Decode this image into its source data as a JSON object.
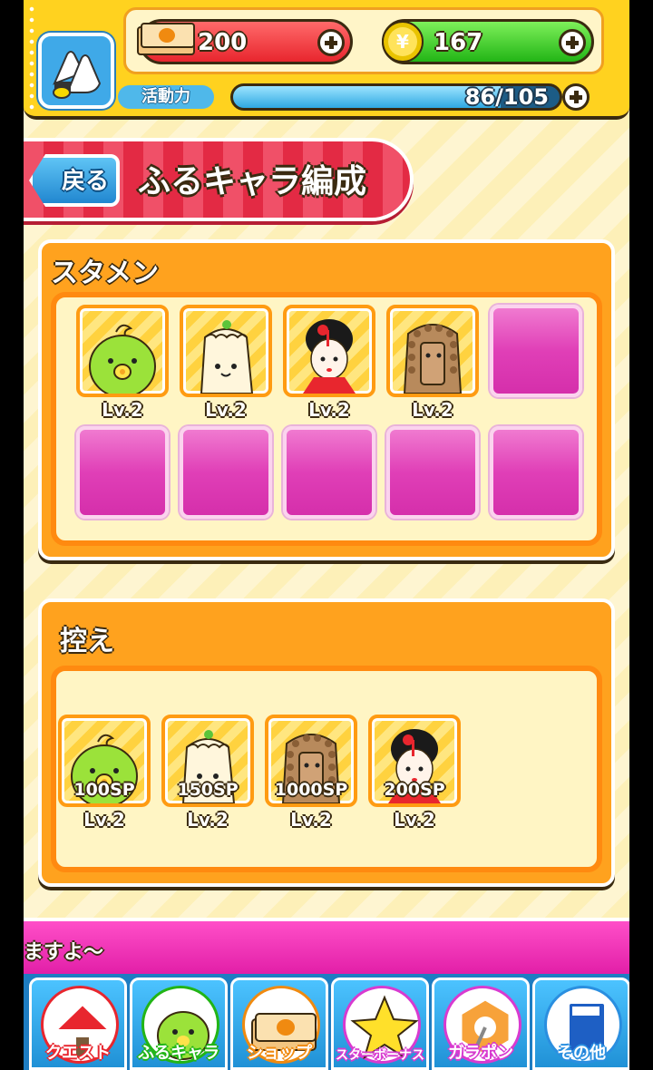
{
  "header": {
    "money": "200",
    "coins": "167",
    "energy_label": "活動力",
    "energy_text": "86/105",
    "energy_fraction": 0.819
  },
  "title_banner": {
    "back_label": "戻る",
    "title": "ふるキャラ編成"
  },
  "starter": {
    "title": "スタメン",
    "slots": [
      {
        "character": "green-bird",
        "level": "Lv.2"
      },
      {
        "character": "white-bun",
        "level": "Lv.2"
      },
      {
        "character": "maiko-girl",
        "level": "Lv.2"
      },
      {
        "character": "brown-statue",
        "level": "Lv.2"
      },
      {
        "character": "empty"
      },
      {
        "character": "empty"
      },
      {
        "character": "empty"
      },
      {
        "character": "empty"
      },
      {
        "character": "empty"
      },
      {
        "character": "empty"
      }
    ]
  },
  "reserve": {
    "title": "控え",
    "slots": [
      {
        "character": "green-bird",
        "sp": "100SP",
        "level": "Lv.2"
      },
      {
        "character": "white-bun",
        "sp": "150SP",
        "level": "Lv.2"
      },
      {
        "character": "brown-statue",
        "sp": "1000SP",
        "level": "Lv.2"
      },
      {
        "character": "maiko-girl",
        "sp": "200SP",
        "level": "Lv.2"
      }
    ]
  },
  "ticker": {
    "text": "ますよ～"
  },
  "nav": {
    "items": [
      {
        "label": "クエスト",
        "color": "#e8262e",
        "icon": "tent-icon"
      },
      {
        "label": "ふるキャラ",
        "color": "#22b516",
        "icon": "green-bird-icon"
      },
      {
        "label": "ショップ",
        "color": "#f08a10",
        "icon": "money-stack-icon"
      },
      {
        "label": "スターボーナス",
        "color": "#d83ad0",
        "icon": "star-icon"
      },
      {
        "label": "ガラポン",
        "color": "#d83ad0",
        "icon": "lottery-wheel-icon"
      },
      {
        "label": "その他",
        "color": "#2a8fe0",
        "icon": "book-icon"
      }
    ]
  },
  "colors": {
    "accent_orange": "#ffa21e",
    "empty_slot_pink": "#e03fb7",
    "header_yellow": "#ffd21f"
  }
}
